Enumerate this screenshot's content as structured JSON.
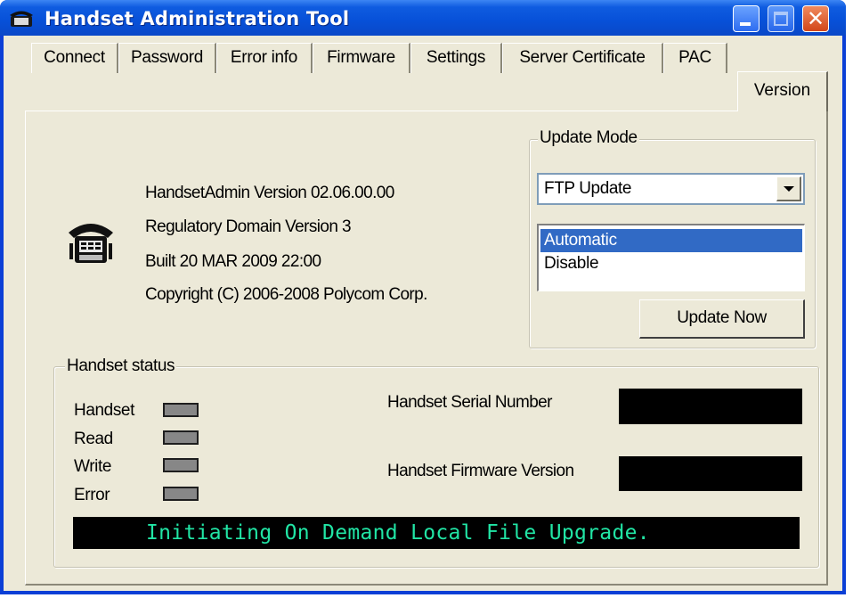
{
  "window": {
    "title": "Handset Administration Tool",
    "controls": [
      "minimize",
      "maximize",
      "close"
    ],
    "close_glyph": "✕"
  },
  "tabs": [
    {
      "label": "Connect",
      "active": false
    },
    {
      "label": "Password",
      "active": false
    },
    {
      "label": "Error info",
      "active": false
    },
    {
      "label": "Firmware",
      "active": false
    },
    {
      "label": "Settings",
      "active": false
    },
    {
      "label": "Server Certificate",
      "active": false
    },
    {
      "label": "PAC",
      "active": false
    },
    {
      "label": "Version",
      "active": true
    }
  ],
  "version_info": {
    "icon": "telephone-icon",
    "lines": [
      "HandsetAdmin Version 02.06.00.00",
      "Regulatory Domain Version 3",
      "Built 20 MAR 2009   22:00",
      "Copyright (C) 2006-2008 Polycom Corp."
    ]
  },
  "update_mode": {
    "legend": "Update Mode",
    "selected": "FTP Update",
    "options": [
      {
        "label": "Automatic",
        "selected": true
      },
      {
        "label": "Disable",
        "selected": false
      }
    ],
    "button_label": "Update Now"
  },
  "handset_status": {
    "legend": "Handset status",
    "indicators": [
      {
        "label": "Handset"
      },
      {
        "label": "Read"
      },
      {
        "label": "Write"
      },
      {
        "label": "Error"
      }
    ],
    "serial_number_label": "Handset Serial Number",
    "serial_number_value": "",
    "firmware_version_label": "Handset Firmware Version",
    "firmware_version_value": "",
    "message": "Initiating On Demand Local File Upgrade."
  },
  "colors": {
    "titlebar": "#0750d8",
    "face": "#ece9d8",
    "selection": "#316ac5",
    "led": "#878787",
    "message_text": "#21e5a5"
  }
}
